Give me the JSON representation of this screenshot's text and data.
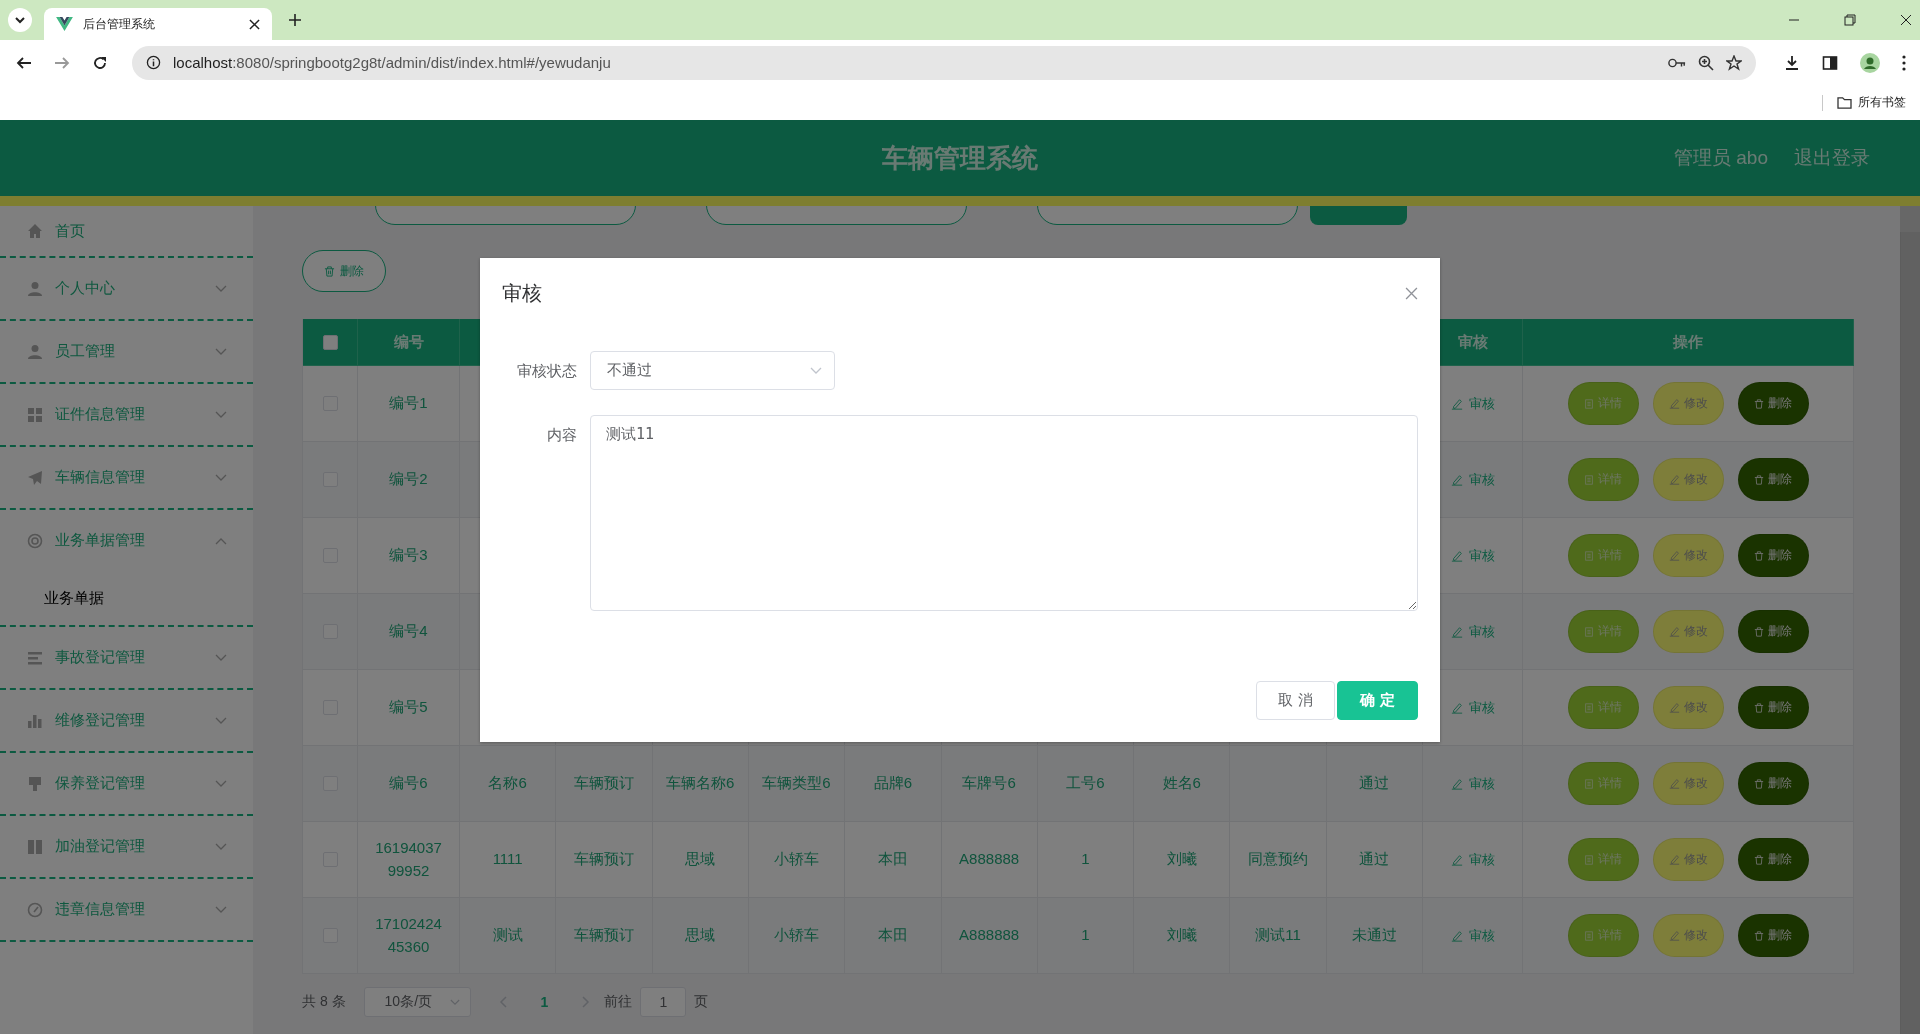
{
  "browser": {
    "tab_title": "后台管理系统",
    "url_host": "localhost",
    "url_path": ":8080/springbootg2g8t/admin/dist/index.html#/yewudanju",
    "bookmarks_label": "所有书签"
  },
  "header": {
    "title": "车辆管理系统",
    "user": "管理员 abo",
    "logout": "退出登录"
  },
  "sidebar": {
    "items": [
      {
        "kind": "link",
        "label": "首页"
      },
      {
        "kind": "menu",
        "label": "个人中心",
        "expanded": false
      },
      {
        "kind": "menu",
        "label": "员工管理",
        "expanded": false
      },
      {
        "kind": "menu",
        "label": "证件信息管理",
        "expanded": false
      },
      {
        "kind": "menu",
        "label": "车辆信息管理",
        "expanded": false
      },
      {
        "kind": "menu",
        "label": "业务单据管理",
        "expanded": true,
        "children": [
          {
            "label": "业务单据",
            "selected": true
          }
        ]
      },
      {
        "kind": "menu",
        "label": "事故登记管理",
        "expanded": false
      },
      {
        "kind": "menu",
        "label": "维修登记管理",
        "expanded": false
      },
      {
        "kind": "menu",
        "label": "保养登记管理",
        "expanded": false
      },
      {
        "kind": "menu",
        "label": "加油登记管理",
        "expanded": false
      },
      {
        "kind": "menu",
        "label": "违章信息管理",
        "expanded": false
      }
    ]
  },
  "toolbar": {
    "delete_button": "删除"
  },
  "table": {
    "select_all_checked": false,
    "columns": {
      "id": "编号",
      "review": "审核",
      "actions": "操作"
    },
    "rows": [
      {
        "checked": false,
        "id": "编号1",
        "review": "审核",
        "actions": [
          {
            "kind": "detail",
            "label": "详情"
          },
          {
            "kind": "edit",
            "label": "修改"
          },
          {
            "kind": "delete",
            "label": "删除"
          }
        ]
      },
      {
        "checked": false,
        "id": "编号2",
        "review": "审核",
        "actions": [
          {
            "kind": "detail",
            "label": "详情"
          },
          {
            "kind": "edit",
            "label": "修改"
          },
          {
            "kind": "delete",
            "label": "删除"
          }
        ]
      },
      {
        "checked": false,
        "id": "编号3",
        "review": "审核",
        "actions": [
          {
            "kind": "detail",
            "label": "详情"
          },
          {
            "kind": "edit",
            "label": "修改"
          },
          {
            "kind": "delete",
            "label": "删除"
          }
        ]
      },
      {
        "checked": false,
        "id": "编号4",
        "review": "审核",
        "actions": [
          {
            "kind": "detail",
            "label": "详情"
          },
          {
            "kind": "edit",
            "label": "修改"
          },
          {
            "kind": "delete",
            "label": "删除"
          }
        ]
      },
      {
        "checked": false,
        "id": "编号5",
        "review": "审核",
        "actions": [
          {
            "kind": "detail",
            "label": "详情"
          },
          {
            "kind": "edit",
            "label": "修改"
          },
          {
            "kind": "delete",
            "label": "删除"
          }
        ]
      },
      {
        "checked": false,
        "id": "编号6",
        "cells": [
          "名称6",
          "车辆预订",
          "车辆名称6",
          "车辆类型6",
          "品牌6",
          "车牌号6",
          "工号6",
          "姓名6",
          null,
          "通过"
        ],
        "review": "审核",
        "actions": [
          {
            "kind": "detail",
            "label": "详情"
          },
          {
            "kind": "edit",
            "label": "修改"
          },
          {
            "kind": "delete",
            "label": "删除"
          }
        ]
      },
      {
        "checked": false,
        "id": "1619403799952",
        "cells": [
          "1111",
          "车辆预订",
          "思域",
          "小轿车",
          "本田",
          "A888888",
          "1",
          "刘曦",
          "同意预约",
          "通过"
        ],
        "review": "审核",
        "actions": [
          {
            "kind": "detail",
            "label": "详情"
          },
          {
            "kind": "edit",
            "label": "修改"
          },
          {
            "kind": "delete",
            "label": "删除"
          }
        ]
      },
      {
        "checked": false,
        "id": "1710242445360",
        "cells": [
          "测试",
          "车辆预订",
          "思域",
          "小轿车",
          "本田",
          "A888888",
          "1",
          "刘曦",
          "测试11",
          "未通过"
        ],
        "review": "审核",
        "actions": [
          {
            "kind": "detail",
            "label": "详情"
          },
          {
            "kind": "edit",
            "label": "修改"
          },
          {
            "kind": "delete",
            "label": "删除"
          }
        ]
      }
    ]
  },
  "pagination": {
    "total": "共 8 条",
    "page_size": "10条/页",
    "pages": [
      {
        "label": "1",
        "selected": true
      }
    ],
    "goto_label": "前往",
    "goto_value": "1",
    "page_unit": "页"
  },
  "dialog": {
    "title": "审核",
    "fields": [
      {
        "kind": "select",
        "label": "审核状态",
        "value": "不通过"
      },
      {
        "kind": "textarea",
        "label": "内容",
        "value": "测试11"
      }
    ],
    "buttons": [
      {
        "kind": "secondary",
        "label": "取 消"
      },
      {
        "kind": "primary",
        "label": "确 定"
      }
    ]
  }
}
